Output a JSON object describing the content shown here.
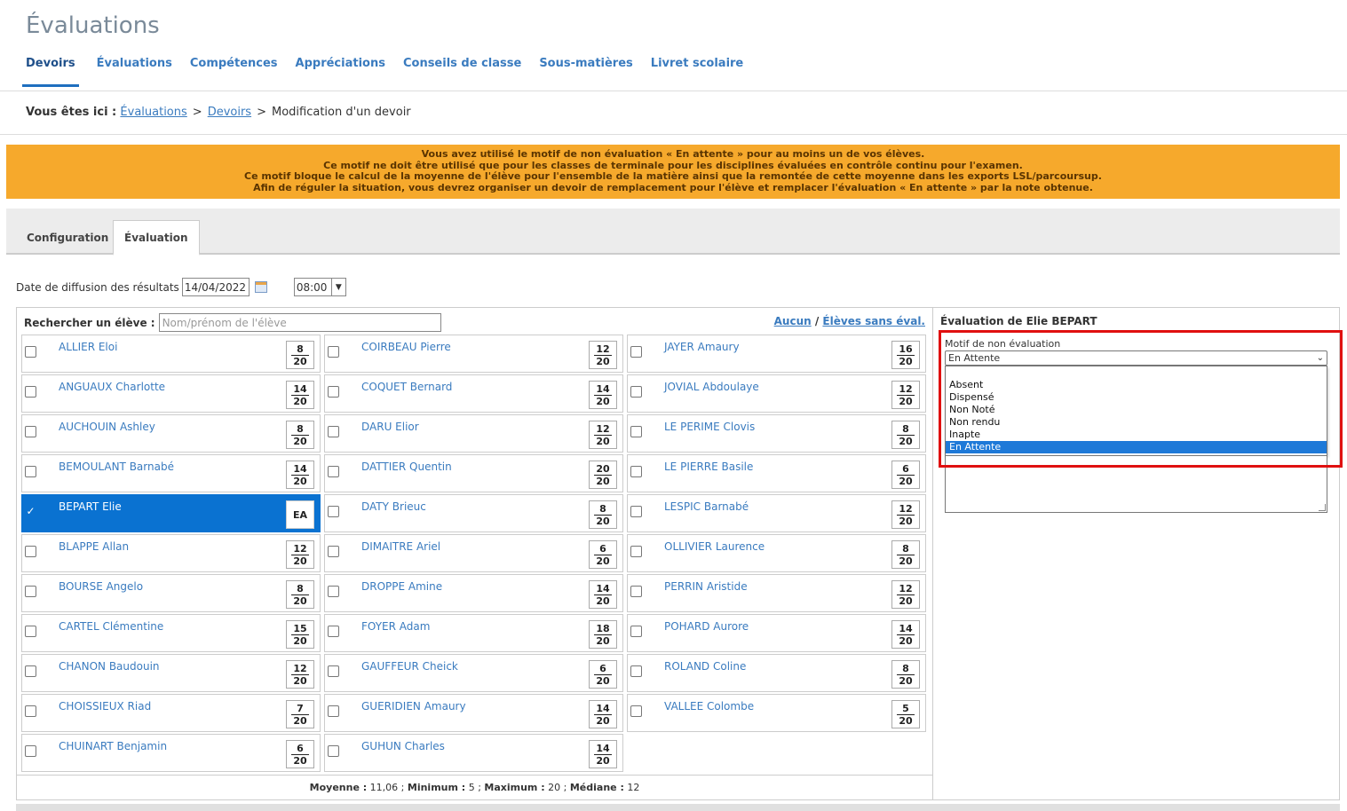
{
  "page": {
    "title": "Évaluations"
  },
  "nav": {
    "items": [
      {
        "label": "Devoirs",
        "active": true
      },
      {
        "label": "Évaluations"
      },
      {
        "label": "Compétences"
      },
      {
        "label": "Appréciations"
      },
      {
        "label": "Conseils de classe"
      },
      {
        "label": "Sous-matières"
      },
      {
        "label": "Livret scolaire"
      }
    ]
  },
  "breadcrumb": {
    "prefix": "Vous êtes ici :",
    "link1": "Évaluations",
    "link2": "Devoirs",
    "sep": ">",
    "current": "Modification d'un devoir"
  },
  "warning": {
    "line1": "Vous avez utilisé le motif de non évaluation « En attente » pour au moins un de vos élèves.",
    "line2": "Ce motif ne doit être utilisé que pour les classes de terminale pour les disciplines évaluées en contrôle continu pour l'examen.",
    "line3": "Ce motif bloque le calcul de la moyenne de l'élève pour l'ensemble de la matière ainsi que la remontée de cette moyenne dans les exports LSL/parcoursup.",
    "line4": "Afin de réguler la situation, vous devrez organiser un devoir de remplacement pour l'élève et remplacer l'évaluation « En attente » par la note obtenue."
  },
  "tabs": {
    "config": "Configuration",
    "evaluation": "Évaluation"
  },
  "diffusion": {
    "label": "Date de diffusion des résultats",
    "date": "14/04/2022",
    "time": "08:00"
  },
  "search": {
    "label": "Rechercher un élève :",
    "placeholder": "Nom/prénom de l'élève"
  },
  "filters": {
    "none": "Aucun",
    "sep": "/",
    "without_eval": "Élèves sans éval."
  },
  "grade_max": "20",
  "students": [
    {
      "name": "ALLIER Eloi",
      "grade": "8"
    },
    {
      "name": "ANGUAUX Charlotte",
      "grade": "14"
    },
    {
      "name": "AUCHOUIN Ashley",
      "grade": "8"
    },
    {
      "name": "BEMOULANT Barnabé",
      "grade": "14"
    },
    {
      "name": "BEPART Elie",
      "grade": "EA",
      "selected": true
    },
    {
      "name": "BLAPPE Allan",
      "grade": "12"
    },
    {
      "name": "BOURSE Angelo",
      "grade": "8"
    },
    {
      "name": "CARTEL Clémentine",
      "grade": "15"
    },
    {
      "name": "CHANON Baudouin",
      "grade": "12"
    },
    {
      "name": "CHOISSIEUX Riad",
      "grade": "7"
    },
    {
      "name": "CHUINART Benjamin",
      "grade": "6"
    },
    {
      "name": "COIRBEAU Pierre",
      "grade": "12"
    },
    {
      "name": "COQUET Bernard",
      "grade": "14"
    },
    {
      "name": "DARU Elior",
      "grade": "12"
    },
    {
      "name": "DATTIER Quentin",
      "grade": "20"
    },
    {
      "name": "DATY Brieuc",
      "grade": "8"
    },
    {
      "name": "DIMAITRE Ariel",
      "grade": "6"
    },
    {
      "name": "DROPPE Amine",
      "grade": "14"
    },
    {
      "name": "FOYER Adam",
      "grade": "18"
    },
    {
      "name": "GAUFFEUR Cheick",
      "grade": "6"
    },
    {
      "name": "GUERIDIEN Amaury",
      "grade": "14"
    },
    {
      "name": "GUHUN Charles",
      "grade": "14"
    },
    {
      "name": "JAYER Amaury",
      "grade": "16"
    },
    {
      "name": "JOVIAL Abdoulaye",
      "grade": "12"
    },
    {
      "name": "LE PERIME Clovis",
      "grade": "8"
    },
    {
      "name": "LE PIERRE Basile",
      "grade": "6"
    },
    {
      "name": "LESPIC Barnabé",
      "grade": "12"
    },
    {
      "name": "OLLIVIER Laurence",
      "grade": "8"
    },
    {
      "name": "PERRIN Aristide",
      "grade": "12"
    },
    {
      "name": "POHARD Aurore",
      "grade": "14"
    },
    {
      "name": "ROLAND Coline",
      "grade": "8"
    },
    {
      "name": "VALLEE Colombe",
      "grade": "5"
    }
  ],
  "stats": {
    "avg_label": "Moyenne :",
    "avg": "11,06",
    "min_label": "Minimum :",
    "min": "5",
    "max_label": "Maximum :",
    "max": "20",
    "med_label": "Médiane :",
    "med": "12",
    "sep": ";"
  },
  "eval_panel": {
    "title": "Évaluation de Elie BEPART",
    "motif_label": "Motif de non évaluation",
    "motif_selected": "En Attente",
    "options": [
      "Absent",
      "Dispensé",
      "Non Noté",
      "Non rendu",
      "Inapte",
      "En Attente"
    ],
    "selected_option": "En Attente"
  },
  "colors": {
    "accent": "#0a72d1",
    "warning_bg": "#f6a92c",
    "highlight": "#e01010",
    "link": "#3a7bbf"
  }
}
